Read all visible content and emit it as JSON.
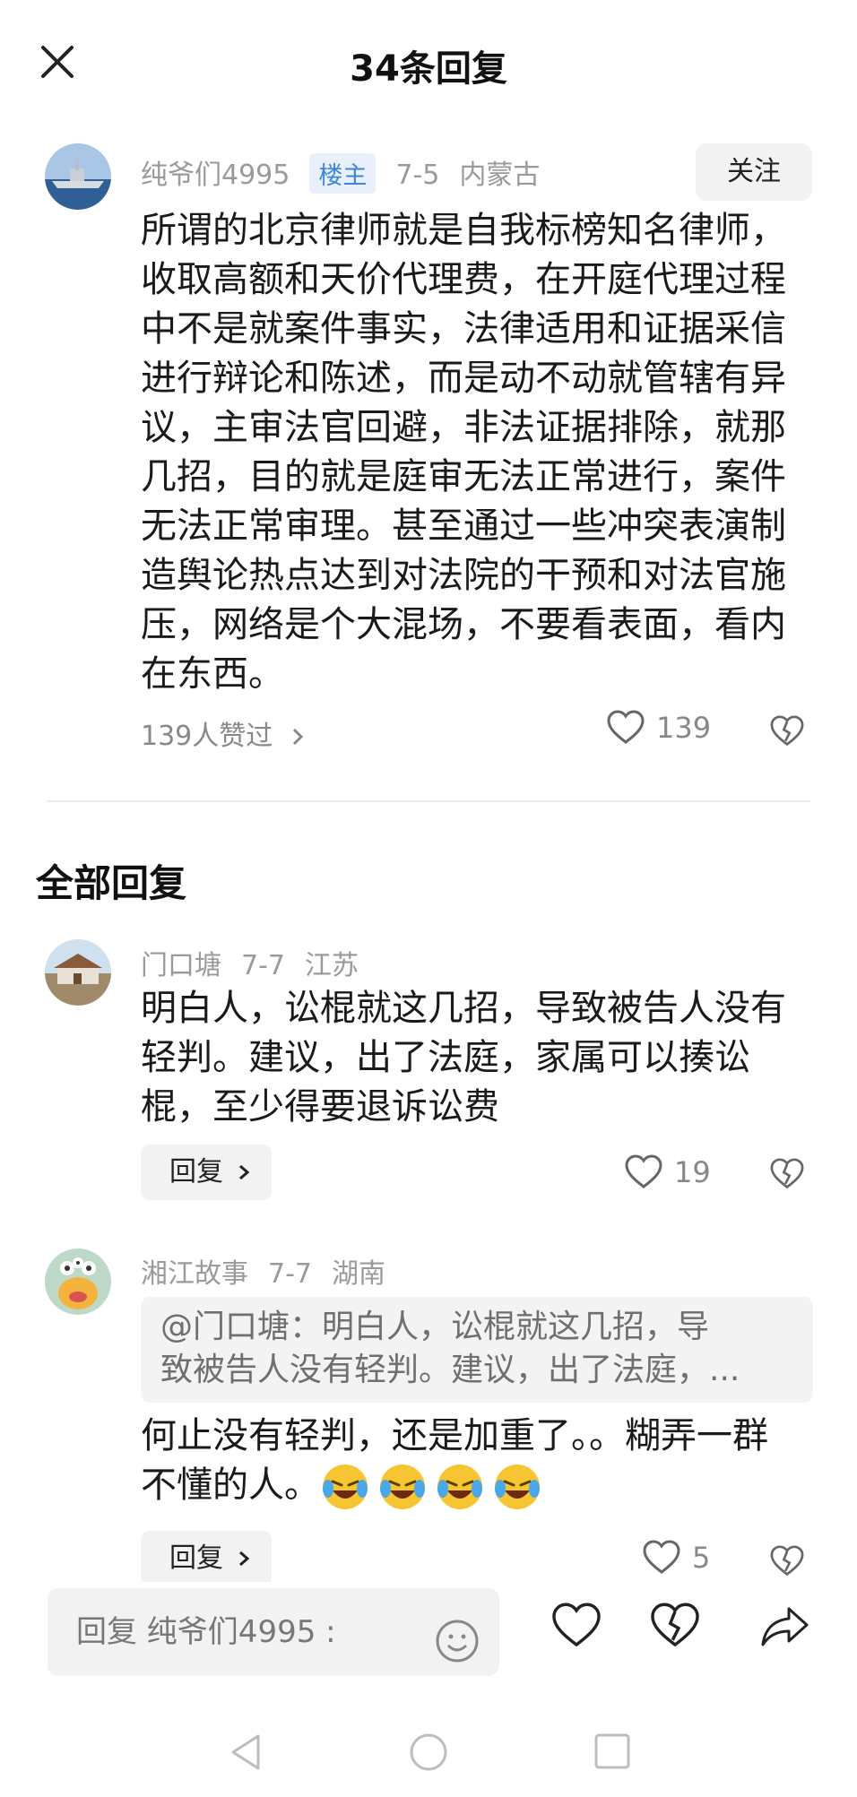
{
  "header": {
    "title": "34条回复"
  },
  "main_comment": {
    "username": "纯爷们4995",
    "badge": "楼主",
    "date": "7-5",
    "location": "内蒙古",
    "follow_label": "关注",
    "text": "所谓的北京律师就是自我标榜知名律师，收取高额和天价代理费，在开庭代理过程中不是就案件事实，法律适用和证据采信进行辩论和陈述，而是动不动就管辖有异议，主审法官回避，非法证据排除，就那几招，目的就是庭审无法正常进行，案件无法正常审理。甚至通过一些冲突表演制造舆论热点达到对法院的干预和对法官施压，网络是个大混场，不要看表面，看内在东西。",
    "likers_text": "139人赞过",
    "like_count": "139",
    "avatar_icon": "warship-photo"
  },
  "section": {
    "title": "全部回复"
  },
  "replies": [
    {
      "username": "门口塘",
      "date": "7-7",
      "location": "江苏",
      "text": "明白人，讼棍就这几招，导致被告人没有轻判。建议，出了法庭，家属可以揍讼棍，至少得要退诉讼费",
      "reply_label": "回复",
      "like_count": "19",
      "avatar_icon": "house-photo"
    },
    {
      "username": "湘江故事",
      "date": "7-7",
      "location": "湖南",
      "quote_line1": "@门口塘：明白人，讼棍就这几招，导",
      "quote_line2": "致被告人没有轻判。建议，出了法庭，...",
      "text": "何止没有轻判，还是加重了。。糊弄一群不懂的人。",
      "emoji_count": 4,
      "emoji_icon": "crying-laughing-emoji",
      "reply_label": "回复",
      "like_count": "5",
      "avatar_icon": "cartoon-monster"
    }
  ],
  "bottom_bar": {
    "input_placeholder": "回复 纯爷们4995 :"
  },
  "colors": {
    "accent": "#3f86d8",
    "muted": "#9a9a9a",
    "chip": "#f2f2f2"
  }
}
